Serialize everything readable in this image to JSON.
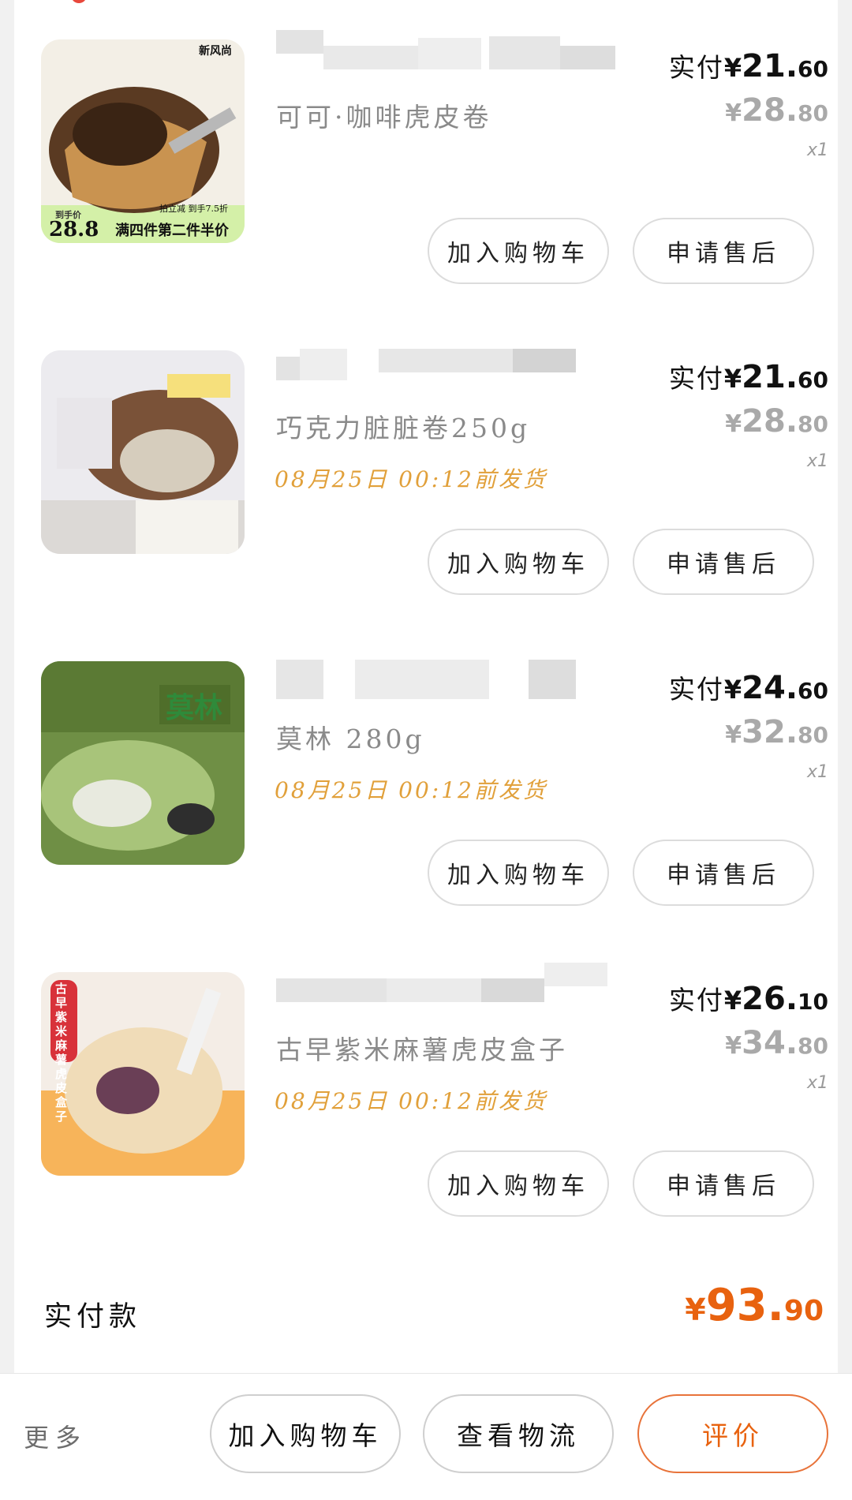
{
  "labels": {
    "paid": "实付",
    "currency": "¥",
    "add_to_cart": "加入购物车",
    "after_sale": "申请售后"
  },
  "items": [
    {
      "name": "可可·咖啡虎皮卷",
      "ship_time": "",
      "paid_int": "21.",
      "paid_dec": "60",
      "orig_int": "28.",
      "orig_dec": "80",
      "qty": "x1",
      "thumb_texts": [
        "新风尚",
        "到手价",
        "28.8",
        "满四件第二件半价",
        "拍立减 到手7.5折"
      ]
    },
    {
      "name": "巧克力脏脏卷250g",
      "ship_time": "08月25日  00:12前发货",
      "paid_int": "21.",
      "paid_dec": "60",
      "orig_int": "28.",
      "orig_dec": "80",
      "qty": "x1",
      "thumb_texts": []
    },
    {
      "name": "莫林 280g",
      "ship_time": "08月25日  00:12前发货",
      "paid_int": "24.",
      "paid_dec": "60",
      "orig_int": "32.",
      "orig_dec": "80",
      "qty": "x1",
      "thumb_texts": [
        "莫林"
      ]
    },
    {
      "name": "古早紫米麻薯虎皮盒子",
      "ship_time": "08月25日  00:12前发货",
      "paid_int": "26.",
      "paid_dec": "10",
      "orig_int": "34.",
      "orig_dec": "80",
      "qty": "x1",
      "thumb_texts": [
        "古早紫米麻薯虎皮盒子"
      ]
    }
  ],
  "summary": {
    "label": "实付款",
    "currency": "¥",
    "total_int": "93.",
    "total_dec": "90"
  },
  "bottom_bar": {
    "more": "更多",
    "add_to_cart": "加入购物车",
    "track": "查看物流",
    "review": "评价"
  },
  "colors": {
    "accent": "#e8620f",
    "ship_time": "#e1a03a",
    "muted": "#8a8a8a"
  }
}
